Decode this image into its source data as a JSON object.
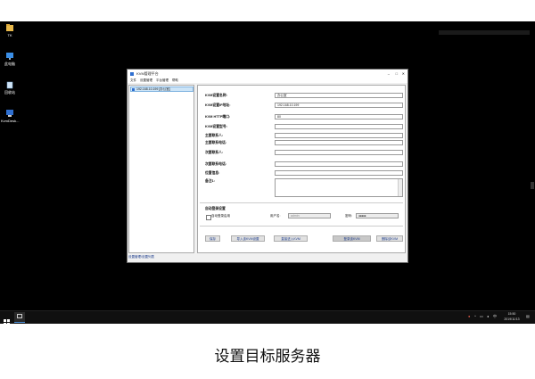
{
  "desktop": {
    "icons": [
      {
        "label": "TK",
        "icon": "folder-icon"
      },
      {
        "label": "此电脑",
        "icon": "computer-icon"
      },
      {
        "label": "回收站",
        "icon": "recycle-bin-icon"
      },
      {
        "label": "KvmDesk...",
        "icon": "kvm-desk-icon"
      }
    ]
  },
  "window": {
    "title": "KVM管理平台",
    "menu": [
      "文件",
      "设置管理",
      "平台管理",
      "帮助"
    ],
    "tree_item": "192.168.10.199 [办公室]",
    "form": {
      "name_label": "KVM设置名称:",
      "name_value": "办公室",
      "ip_label": "KVM设置IP地址:",
      "ip_value": "192.168.10.199",
      "port_label": "KVM HTTP端口:",
      "port_value": "80",
      "model_label": "KVM设置型号:",
      "contact1_label": "主要联系人:",
      "phone1_label": "主要联系电话:",
      "contact2_label": "次要联系人:",
      "phone2_label": "次要联系电话:",
      "location_label": "位置信息:",
      "remark_label": "备注1:"
    },
    "autologin": {
      "section_title": "自动登录设置",
      "checkbox_label": "自动登录启用",
      "username_label": "用户名:",
      "username_value": "admin",
      "password_label": "密码:",
      "password_value": "●●●●●"
    },
    "buttons": {
      "save": "保存",
      "import": "导入该KVM设置",
      "direct": "直接进入KVM",
      "login": "登录该KVM",
      "delete": "删除该KVM"
    },
    "status": "设置管理/设置列表"
  },
  "taskbar": {
    "time": "15:50",
    "date": "2019/11/13"
  },
  "caption": "设置目标服务器"
}
